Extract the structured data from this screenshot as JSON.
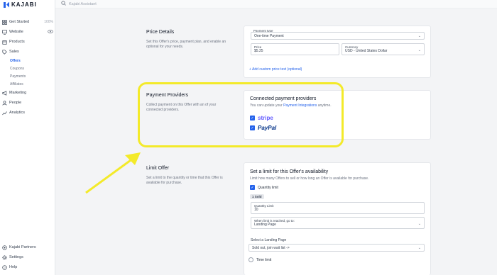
{
  "brand": {
    "name": "KAJABI"
  },
  "search": {
    "placeholder": "Kajabi Assistant"
  },
  "sidebar": {
    "items": [
      {
        "label": "Get Started",
        "trail": "100%",
        "icon": "grid-icon"
      },
      {
        "label": "Website",
        "icon": "monitor-icon"
      },
      {
        "label": "Products",
        "icon": "box-icon"
      },
      {
        "label": "Sales",
        "icon": "tag-icon"
      }
    ],
    "sales_sub": [
      "Offers",
      "Coupons",
      "Payments",
      "Affiliates"
    ],
    "items2": [
      {
        "label": "Marketing",
        "icon": "megaphone-icon"
      },
      {
        "label": "People",
        "icon": "people-icon"
      },
      {
        "label": "Analytics",
        "icon": "chart-icon"
      }
    ],
    "bottom": [
      {
        "label": "Kajabi Partners",
        "icon": "partners-icon"
      },
      {
        "label": "Settings",
        "icon": "gear-icon"
      },
      {
        "label": "Help",
        "icon": "help-icon"
      }
    ]
  },
  "price_details": {
    "title": "Price Details",
    "desc": "Set this Offer's price, payment plan, and enable an optional for your needs.",
    "payment_type_label": "Payment type",
    "payment_type_value": "One-time Payment",
    "price_label": "Price",
    "price_value": "$5.25",
    "currency_label": "Currency",
    "currency_value": "USD - United States Dollar",
    "add_link": "+ Add custom price text (optional)"
  },
  "payment_providers": {
    "title": "Payment Providers",
    "desc": "Collect payment on this Offer with an of your connected providers.",
    "card_title": "Connected payment providers",
    "card_sub_prefix": "You can update your ",
    "card_sub_link": "Payment Integrations",
    "card_sub_suffix": " anytime.",
    "providers": [
      "stripe",
      "PayPal"
    ]
  },
  "limit_offer": {
    "title": "Limit Offer",
    "desc": "Set a limit to the quantity or time that this Offer is available for purchase.",
    "card_title": "Set a limit for this Offer's availability",
    "card_sub": "Limit how many Offers to sell or how long an Offer is available for purchase.",
    "quantity_limit_label": "Quantity limit",
    "sold_badge": "1 Sold",
    "quantity_label": "Quantity Limit",
    "quantity_value": "10",
    "when_label": "When limit is reached, go to:",
    "when_value": "Landing Page",
    "select_landing_label": "Select a Landing Page",
    "landing_value": "Sold out, join wait list ->",
    "time_limit_label": "Time limit"
  },
  "colors": {
    "accent": "#2563eb",
    "highlight": "#f3ea2a"
  }
}
